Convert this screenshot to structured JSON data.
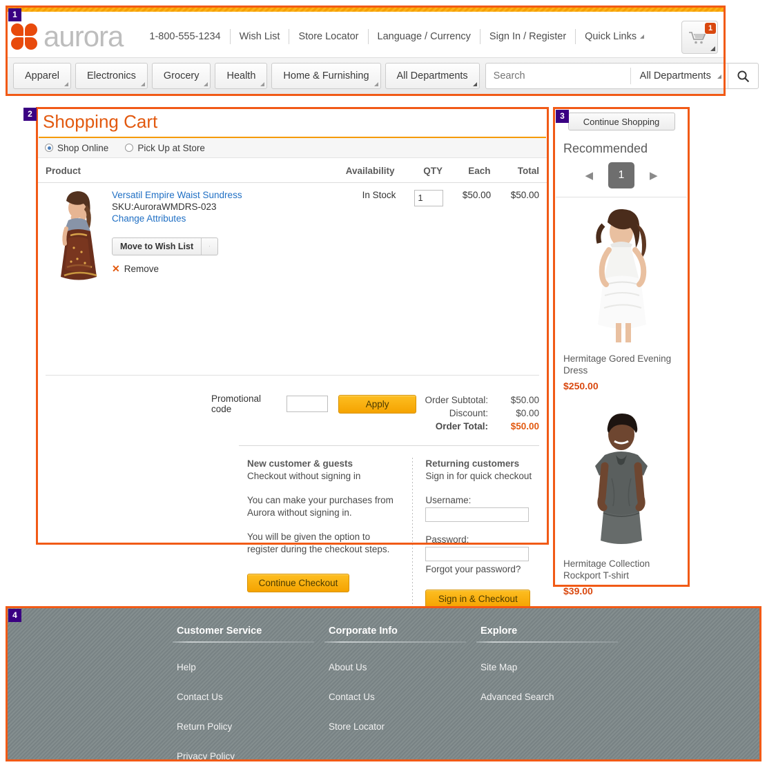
{
  "header": {
    "brand": "aurora",
    "phone": "1-800-555-1234",
    "links": [
      {
        "label": "Wish List",
        "caret": false
      },
      {
        "label": "Store Locator",
        "caret": false
      },
      {
        "label": "Language / Currency",
        "caret": false
      },
      {
        "label": "Sign In / Register",
        "caret": false
      },
      {
        "label": "Quick Links",
        "caret": true
      }
    ],
    "cart": {
      "icon": "shopping-cart-icon",
      "badge": "1"
    },
    "nav": [
      "Apparel",
      "Electronics",
      "Grocery",
      "Health",
      "Home & Furnishing",
      "All Departments"
    ],
    "search": {
      "placeholder": "Search",
      "value": "",
      "department": "All Departments",
      "button_icon": "search-icon"
    }
  },
  "cart": {
    "title": "Shopping Cart",
    "modes": [
      {
        "label": "Shop Online",
        "selected": true
      },
      {
        "label": "Pick Up at Store",
        "selected": false
      }
    ],
    "columns": {
      "product": "Product",
      "availability": "Availability",
      "qty": "QTY",
      "each": "Each",
      "total": "Total"
    },
    "items": [
      {
        "name": "Versatil Empire Waist Sundress",
        "sku": "SKU:AuroraWMDRS-023",
        "change_attributes": "Change Attributes",
        "move_to_wish_list": "Move to Wish List",
        "remove": "Remove",
        "availability": "In Stock",
        "qty": "1",
        "each": "$50.00",
        "total": "$50.00"
      }
    ],
    "promo": {
      "label": "Promotional code",
      "value": "",
      "apply_label": "Apply"
    },
    "totals": [
      {
        "label": "Order Subtotal:",
        "value": "$50.00",
        "emphasis": false
      },
      {
        "label": "Discount:",
        "value": "$0.00",
        "emphasis": false
      },
      {
        "label": "Order Total:",
        "value": "$50.00",
        "emphasis": true
      }
    ],
    "guest": {
      "heading": "New customer & guests",
      "subheading": "Checkout without signing in",
      "p1": "You can make your purchases from Aurora without signing in.",
      "p2": "You will be given the option to register during the checkout steps.",
      "button": "Continue Checkout"
    },
    "returning": {
      "heading": "Returning customers",
      "subheading": "Sign in for quick checkout",
      "username_label": "Username:",
      "username_value": "",
      "password_label": "Password:",
      "password_value": "",
      "forgot": "Forgot your password?",
      "button": "Sign in & Checkout"
    }
  },
  "recommended": {
    "continue_shopping": "Continue Shopping",
    "title": "Recommended",
    "pager": {
      "prev": "◀",
      "current": "1",
      "next": "▶"
    },
    "items": [
      {
        "name": "Hermitage Gored Evening Dress",
        "price": "$250.00"
      },
      {
        "name": "Hermitage Collection Rockport T-shirt",
        "price": "$39.00"
      }
    ]
  },
  "footer": {
    "columns": [
      {
        "heading": "Customer Service",
        "links": [
          "Help",
          "Contact Us",
          "Return Policy",
          "Privacy Policy"
        ]
      },
      {
        "heading": "Corporate Info",
        "links": [
          "About Us",
          "Contact Us",
          "Store Locator"
        ]
      },
      {
        "heading": "Explore",
        "links": [
          "Site Map",
          "Advanced Search"
        ]
      }
    ]
  },
  "annotations": [
    {
      "number": "1"
    },
    {
      "number": "2"
    },
    {
      "number": "3"
    },
    {
      "number": "4"
    }
  ]
}
